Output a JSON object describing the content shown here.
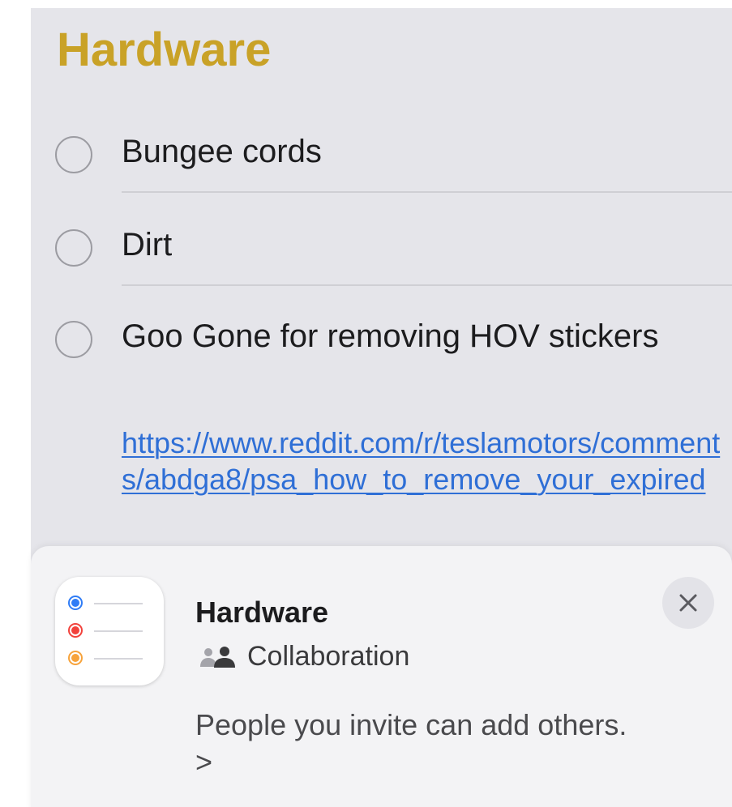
{
  "list": {
    "title": "Hardware",
    "title_color": "#c9a227",
    "items": [
      {
        "text": "Bungee cords",
        "completed": false
      },
      {
        "text": "Dirt",
        "completed": false
      },
      {
        "text": "Goo Gone for removing HOV stickers",
        "completed": false,
        "link": "https://www.reddit.com/r/teslamotors/comments/abdga8/psa_how_to_remove_your_expired"
      }
    ]
  },
  "sheet": {
    "app_icon": "reminders-app-icon",
    "title": "Hardware",
    "subtitle_icon": "people-icon",
    "subtitle": "Collaboration",
    "body": "People you invite can add others. >",
    "close_icon": "close-icon"
  },
  "colors": {
    "link": "#2f6fd6",
    "dot_blue": "#2f7cf6",
    "dot_red": "#f2423c",
    "dot_orange": "#f7a33b"
  }
}
